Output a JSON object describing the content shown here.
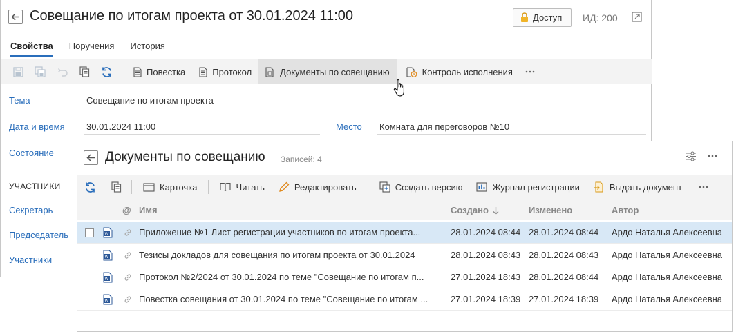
{
  "meeting": {
    "title": "Совещание по итогам проекта от 30.01.2024 11:00",
    "access_label": "Доступ",
    "id_label": "ИД: 200",
    "tabs": [
      {
        "label": "Свойства",
        "active": true
      },
      {
        "label": "Поручения",
        "active": false
      },
      {
        "label": "История",
        "active": false
      }
    ],
    "toolbar": {
      "agenda": "Повестка",
      "protocol": "Протокол",
      "documents": "Документы по совещанию",
      "control": "Контроль исполнения"
    },
    "fields": {
      "topic_label": "Тема",
      "topic_value": "Совещание по итогам проекта",
      "datetime_label": "Дата и время",
      "datetime_value": "30.01.2024 11:00",
      "place_label": "Место",
      "place_value": "Комната для переговоров №10",
      "state_label": "Состояние",
      "participants_section": "УЧАСТНИКИ",
      "secretary_label": "Секретарь",
      "chairman_label": "Председатель",
      "participants_label": "Участники"
    }
  },
  "documents": {
    "title": "Документы по совещанию",
    "count": "Записей: 4",
    "toolbar": {
      "card": "Карточка",
      "read": "Читать",
      "edit": "Редактировать",
      "create_version": "Создать версию",
      "journal": "Журнал регистрации",
      "issue": "Выдать документ"
    },
    "columns": {
      "at": "@",
      "name": "Имя",
      "created": "Создано",
      "modified": "Изменено",
      "author": "Автор"
    },
    "rows": [
      {
        "name": "Приложение №1 Лист регистрации участников по итогам проекта...",
        "created": "28.01.2024 08:44",
        "modified": "28.01.2024 08:44",
        "author": "Ардо Наталья Алексеевна",
        "selected": true
      },
      {
        "name": "Тезисы докладов для совещания по итогам проекта от 30.01.2024",
        "created": "28.01.2024 08:43",
        "modified": "28.01.2024 08:43",
        "author": "Ардо Наталья Алексеевна",
        "selected": false
      },
      {
        "name": "Протокол №2/2024 от 30.01.2024 по теме \"Совещание по итогам п...",
        "created": "27.01.2024 18:43",
        "modified": "28.01.2024 08:44",
        "author": "Ардо Наталья Алексеевна",
        "selected": false
      },
      {
        "name": "Повестка совещания от 30.01.2024 по теме \"Совещание по итогам ...",
        "created": "27.01.2024 18:39",
        "modified": "27.01.2024 18:39",
        "author": "Ардо Наталья Алексеевна",
        "selected": false
      }
    ]
  },
  "colors": {
    "accent": "#2a6ebb",
    "selected_row": "#d8e8f6",
    "toolbar_bg": "#f3f3f3"
  }
}
